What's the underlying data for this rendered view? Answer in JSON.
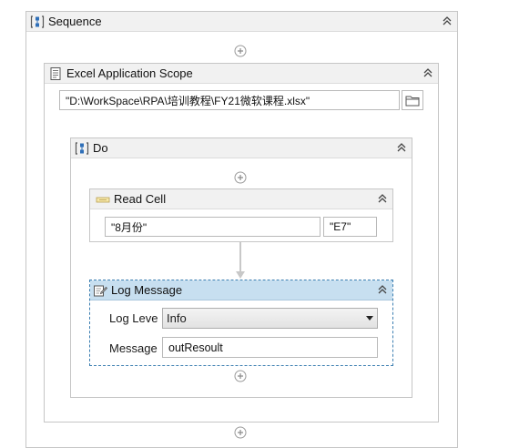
{
  "sequence": {
    "title": "Sequence"
  },
  "excel_scope": {
    "title": "Excel Application Scope",
    "workbook_path": "\"D:\\WorkSpace\\RPA\\培训教程\\FY21微软课程.xlsx\""
  },
  "do_block": {
    "title": "Do"
  },
  "read_cell": {
    "title": "Read Cell",
    "sheet_name": "\"8月份\"",
    "cell": "\"E7\""
  },
  "log_message": {
    "title": "Log Message",
    "level_label": "Log Leve",
    "level_value": "Info",
    "message_label": "Message",
    "message_value": "outResoult"
  },
  "icons": {
    "sequence": "sequence-icon",
    "excel": "excel-scope-icon",
    "do": "do-icon",
    "read_cell": "read-cell-icon",
    "log": "log-message-icon",
    "folder": "folder-icon",
    "collapse": "chevron-double-up-icon",
    "add": "add-activity-icon"
  },
  "colors": {
    "selected_header": "#c7dff0",
    "selected_border": "#3c7fb1",
    "header_bg": "#f1f1f1",
    "border": "#c6c6c6"
  }
}
